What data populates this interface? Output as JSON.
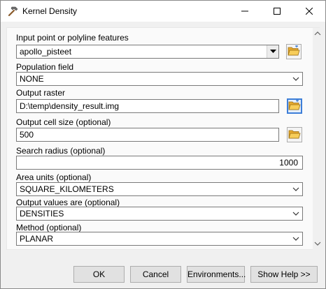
{
  "window": {
    "title": "Kernel Density",
    "title_icon": "hammer-icon",
    "controls": [
      "minimize-icon",
      "maximize-icon",
      "close-icon"
    ]
  },
  "form": {
    "input_features": {
      "label": "Input point or polyline features",
      "value": "apollo_pisteet"
    },
    "population_field": {
      "label": "Population field",
      "value": "NONE"
    },
    "output_raster": {
      "label": "Output raster",
      "value": "D:\\temp\\density_result.img"
    },
    "output_cell_size": {
      "label": "Output cell size (optional)",
      "value": "500"
    },
    "search_radius": {
      "label": "Search radius (optional)",
      "value": "1000"
    },
    "area_units": {
      "label": "Area units (optional)",
      "value": "SQUARE_KILOMETERS"
    },
    "output_values": {
      "label": "Output values are (optional)",
      "value": "DENSITIES"
    },
    "method": {
      "label": "Method (optional)",
      "value": "PLANAR"
    }
  },
  "buttons": {
    "ok": "OK",
    "cancel": "Cancel",
    "environments": "Environments...",
    "show_help": "Show Help >>"
  },
  "colors": {
    "focus_border": "#3d7ed8",
    "folder_yellow": "#f2c14e"
  }
}
